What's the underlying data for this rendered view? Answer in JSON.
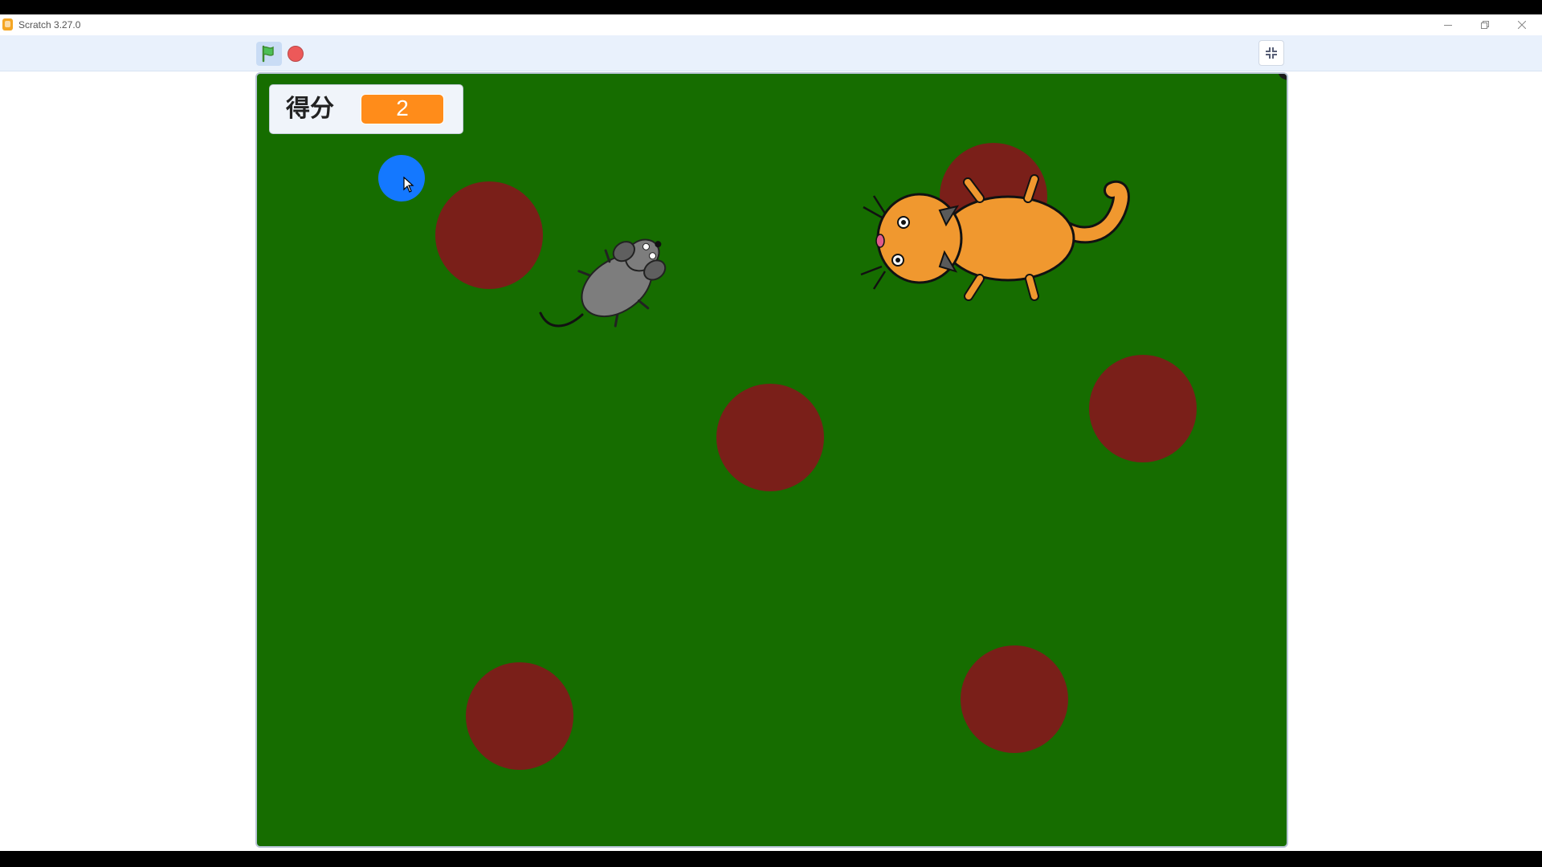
{
  "window": {
    "title": "Scratch 3.27.0",
    "controls": [
      "minimize-icon",
      "restore-icon",
      "close-icon"
    ]
  },
  "player": {
    "green_flag": "green-flag-icon",
    "stop": "stop-icon",
    "fullscreen": "exit-fullscreen-icon"
  },
  "stage": {
    "background_color": "#166d00",
    "monitor": {
      "label": "得分",
      "value": "2"
    },
    "sprites": [
      "blue-ball",
      "mouse",
      "cat",
      "red-dot"
    ]
  },
  "colors": {
    "dot": "#7a1f19",
    "ball": "#1478ff",
    "monitor_value": "#ff8c1a",
    "cat": "#f0982f",
    "mouse": "#7d7d7d"
  }
}
